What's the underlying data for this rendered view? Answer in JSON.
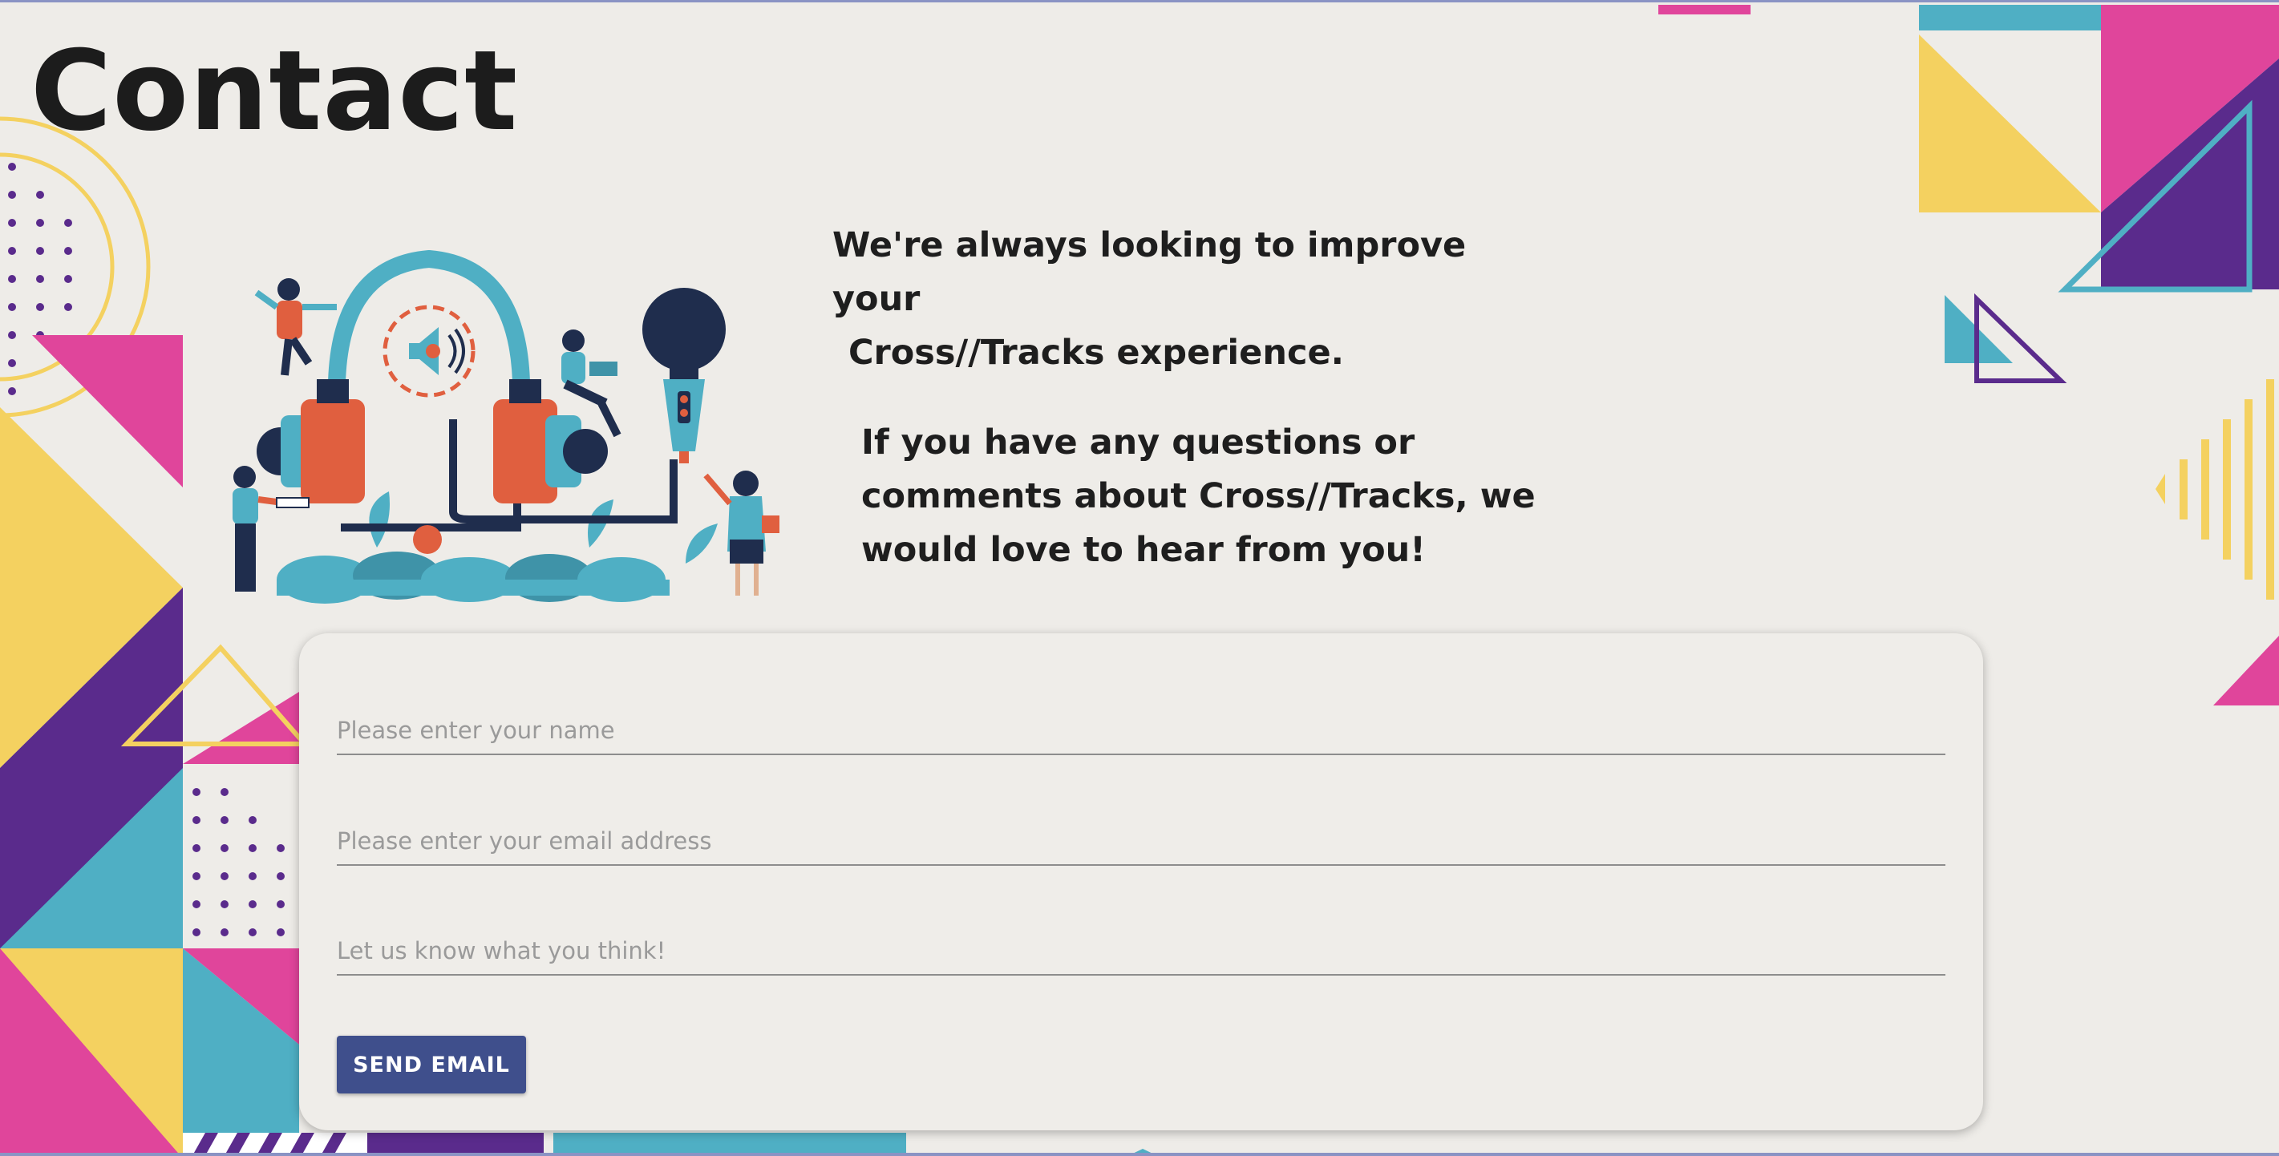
{
  "page": {
    "title": "Contact"
  },
  "intro": {
    "line1": "We're always looking to improve your",
    "line2": "Cross//Tracks experience.",
    "line3": "If you have any questions or comments about Cross//Tracks, we would love to hear from you!"
  },
  "form": {
    "name_placeholder": "Please enter your name",
    "email_placeholder": "Please enter your email address",
    "message_placeholder": "Let us know what you think!",
    "send_label": "SEND EMAIL"
  },
  "colors": {
    "background": "#eeece8",
    "pink": "#e0459b",
    "yellow": "#f4d160",
    "purple": "#5a2b8c",
    "teal": "#4fafc4",
    "button": "#3f4f8c",
    "orange": "#e05f3f",
    "navy": "#1f2d4d"
  },
  "icons": [
    "speaker-icon",
    "headphones-icon",
    "microphone-icon"
  ]
}
